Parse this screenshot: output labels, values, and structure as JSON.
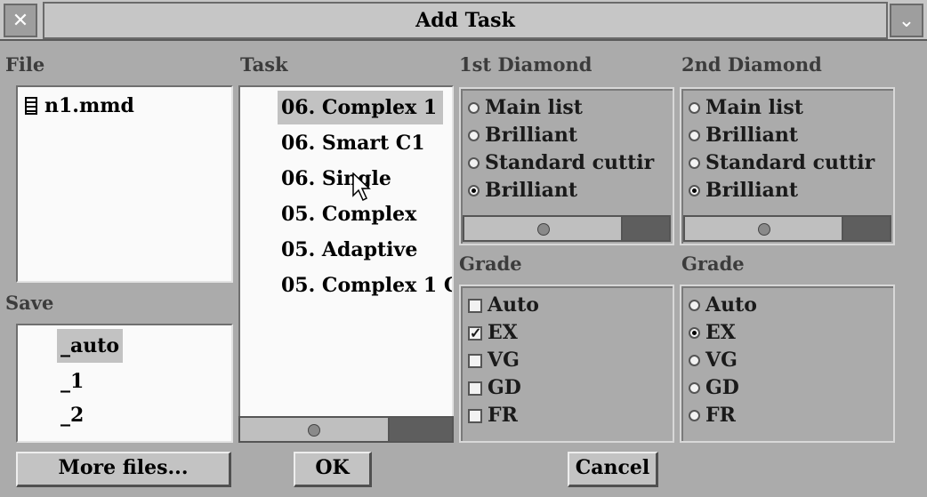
{
  "window": {
    "title": "Add Task"
  },
  "titlebar": {
    "close_glyph": "✕",
    "menu_glyph": "⌄"
  },
  "file": {
    "label": "File",
    "items": [
      {
        "name": "n1.mmd",
        "icon": "document-icon"
      }
    ]
  },
  "save": {
    "label": "Save",
    "items": [
      "_auto",
      "_1",
      "_2"
    ],
    "selected": "_auto"
  },
  "task": {
    "label": "Task",
    "items": [
      "06. Complex 1",
      "06. Smart C1",
      "06. Single",
      "05. Complex",
      "05. Adaptive",
      "05. Complex 1 C"
    ],
    "selected": "06. Complex 1"
  },
  "diamond1": {
    "label": "1st Diamond",
    "options": [
      "Main list",
      "Brilliant",
      "Standard cuttir",
      "Brilliant"
    ],
    "selected_index": 3
  },
  "diamond2": {
    "label": "2nd Diamond",
    "options": [
      "Main list",
      "Brilliant",
      "Standard cuttir",
      "Brilliant"
    ],
    "selected_index": 3
  },
  "grade1": {
    "label": "Grade",
    "options": [
      "Auto",
      "EX",
      "VG",
      "GD",
      "FR"
    ],
    "checked": [
      "EX"
    ]
  },
  "grade2": {
    "label": "Grade",
    "options": [
      "Auto",
      "EX",
      "VG",
      "GD",
      "FR"
    ],
    "selected": "EX"
  },
  "buttons": {
    "more_files": "More files...",
    "ok": "OK",
    "cancel": "Cancel"
  },
  "colors": {
    "window_bg": "#ababab",
    "list_bg": "#fafafa",
    "selection": "#c2c2c2"
  }
}
